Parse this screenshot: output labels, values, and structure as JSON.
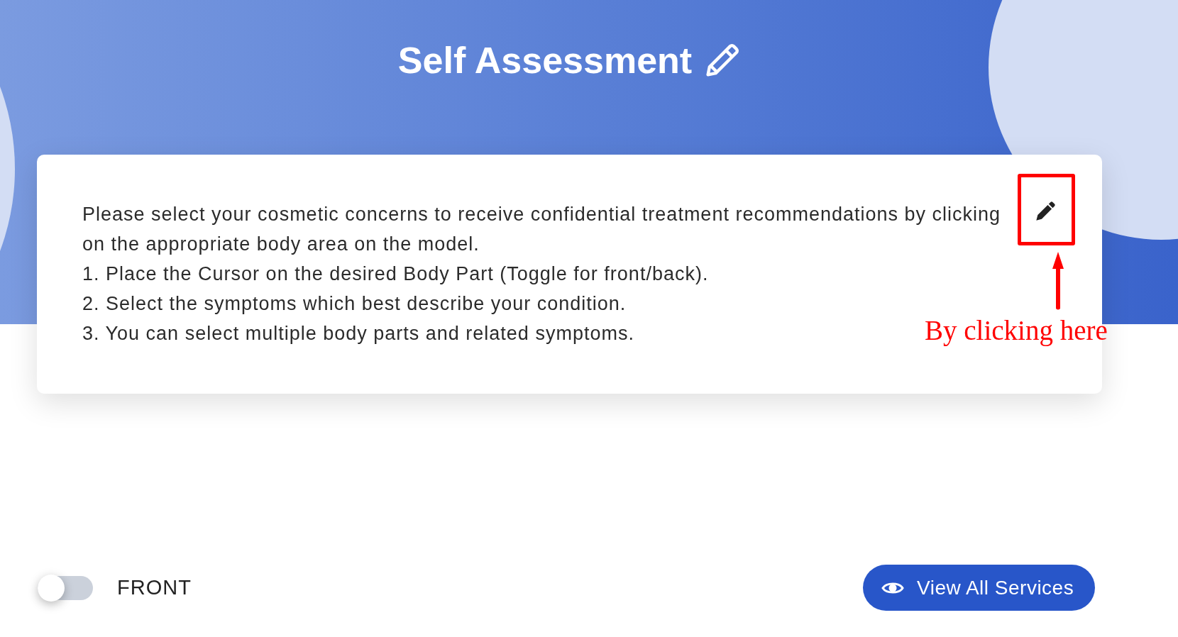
{
  "header": {
    "title": "Self Assessment"
  },
  "instructions": {
    "intro": "Please select your cosmetic concerns to receive confidential treatment recommendations by clicking on the appropriate body area on the model.",
    "steps": [
      "1. Place the Cursor on the desired Body Part (Toggle for front/back).",
      "2. Select the symptoms which best describe your condition.",
      "3. You can select multiple body parts and related symptoms."
    ]
  },
  "annotation": {
    "text": "By clicking here"
  },
  "view_toggle": {
    "label": "FRONT",
    "on": false
  },
  "view_all_button": {
    "label": "View All Services"
  }
}
